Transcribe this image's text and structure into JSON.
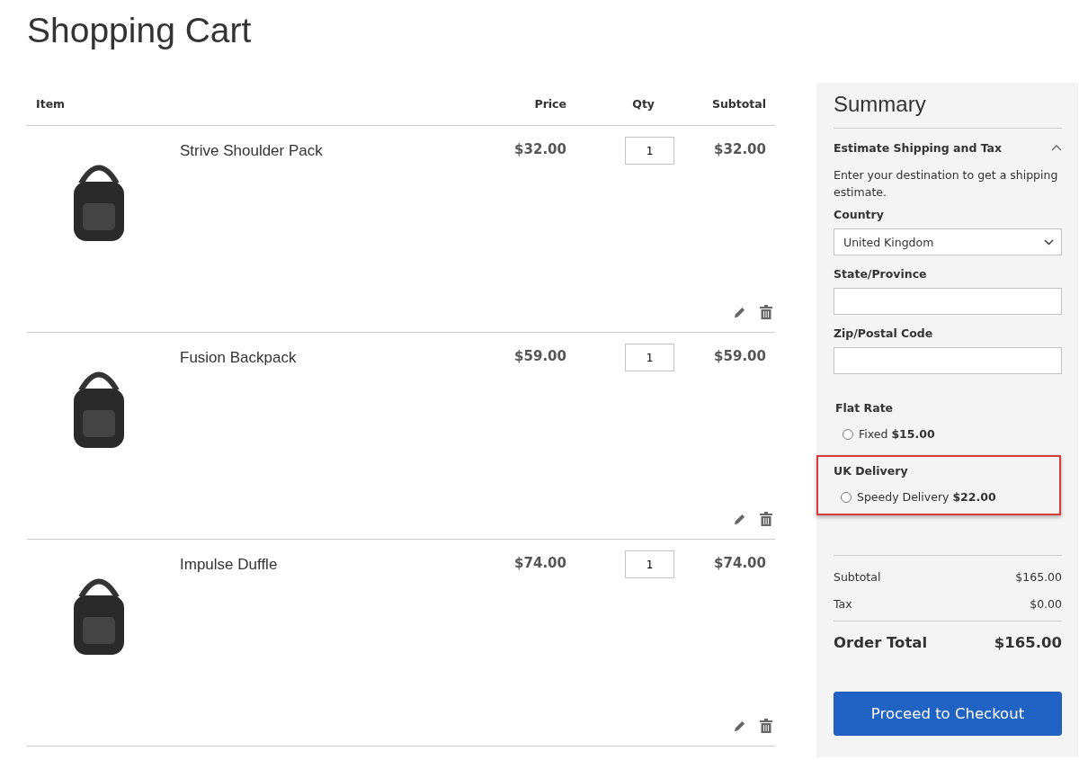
{
  "page_title": "Shopping Cart",
  "cart": {
    "columns": [
      "Item",
      "Price",
      "Qty",
      "Subtotal"
    ],
    "items": [
      {
        "name": "Strive Shoulder Pack",
        "price": "$32.00",
        "qty": "1",
        "subtotal": "$32.00"
      },
      {
        "name": "Fusion Backpack",
        "price": "$59.00",
        "qty": "1",
        "subtotal": "$59.00"
      },
      {
        "name": "Impulse Duffle",
        "price": "$74.00",
        "qty": "1",
        "subtotal": "$74.00"
      }
    ]
  },
  "summary": {
    "title": "Summary",
    "estimate": {
      "title": "Estimate Shipping and Tax",
      "expanded": true,
      "note": "Enter your destination to get a shipping estimate.",
      "fields": [
        {
          "kind": "select",
          "label": "Country",
          "value": "United Kingdom"
        },
        {
          "kind": "text",
          "label": "State/Province"
        },
        {
          "kind": "text",
          "label": "Zip/Postal Code"
        }
      ],
      "shipping_groups": [
        {
          "title": "Flat Rate",
          "highlighted": false,
          "options": [
            {
              "label": "Fixed **$15.00**",
              "selected": false
            }
          ]
        },
        {
          "title": "UK Delivery",
          "highlighted": true,
          "options": [
            {
              "label": "Speedy Delivery **$22.00**",
              "selected": false
            }
          ]
        }
      ]
    },
    "totals": [
      {
        "label": "Subtotal",
        "value": "$165.00"
      },
      {
        "label": "Tax",
        "value": "$0.00"
      }
    ],
    "order_total": {
      "label": "Order Total",
      "value": "$165.00"
    },
    "checkout_button": "Proceed to Checkout"
  }
}
